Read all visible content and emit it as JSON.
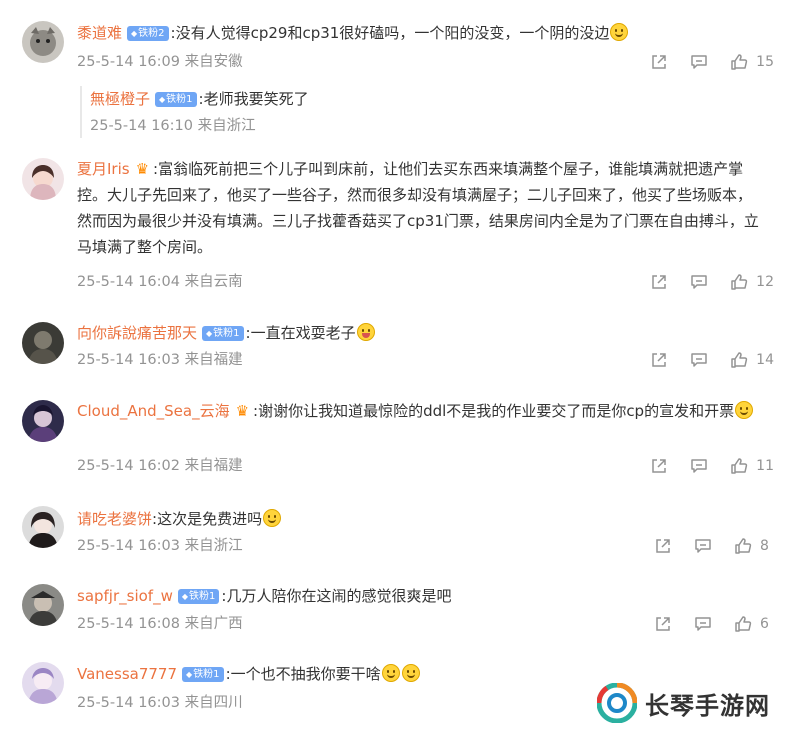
{
  "comments": [
    {
      "username": "黍道难",
      "badge": "铁粉2",
      "text": ":没有人觉得cp29和cp31很好磕吗，一个阳的没变，一个阴的没边",
      "time": "25-5-14 16:09",
      "location": "来自安徽",
      "likes": "15",
      "reply": {
        "username": "無極橙子",
        "badge": "铁粉1",
        "text": ":老师我要笑死了",
        "time": "25-5-14 16:10",
        "location": "来自浙江"
      }
    },
    {
      "username": "夏月Iris",
      "text": ":富翁临死前把三个儿子叫到床前，让他们去买东西来填满整个屋子，谁能填满就把遗产掌控。大儿子先回来了，他买了一些谷子，然而很多却没有填满屋子；二儿子回来了，他买了些场贩本，然而因为最很少并没有填满。三儿子找藿香菇买了cp31门票，结果房间内全是为了门票在自由搏斗，立马填满了整个房间。",
      "time": "25-5-14 16:04",
      "location": "来自云南",
      "likes": "12"
    },
    {
      "username": "向你訴說痛苦那天",
      "badge": "铁粉1",
      "text": ":一直在戏耍老子",
      "time": "25-5-14 16:03",
      "location": "来自福建",
      "likes": "14"
    },
    {
      "username": "Cloud_And_Sea_云海",
      "text": ":谢谢你让我知道最惊险的ddl不是我的作业要交了而是你cp的宣发和开票",
      "time": "25-5-14 16:02",
      "location": "来自福建",
      "likes": "11"
    },
    {
      "username": "请吃老婆饼",
      "text": ":这次是免费进吗",
      "time": "25-5-14 16:03",
      "location": "来自浙江",
      "likes": "8"
    },
    {
      "username": "sapfjr_siof_w",
      "badge": "铁粉1",
      "text": ":几万人陪你在这闹的感觉很爽是吧",
      "time": "25-5-14 16:08",
      "location": "来自广西",
      "likes": "6"
    },
    {
      "username": "Vanessa7777",
      "badge": "铁粉1",
      "text": ":一个也不抽我你要干啥",
      "time": "25-5-14 16:03",
      "location": "来自四川"
    }
  ],
  "watermark": {
    "text": "长琴手游网"
  },
  "colors": {
    "username": "#eb7340",
    "meta": "#939393",
    "badge": "#6fa6f5"
  },
  "icons": {
    "share": "share-icon",
    "comment": "comment-icon",
    "like": "thumbs-up-icon"
  }
}
